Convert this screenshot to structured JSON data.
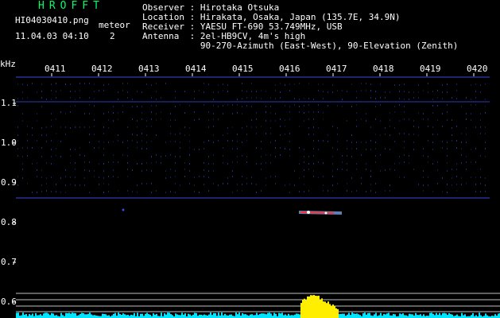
{
  "header": {
    "app_title": "HROFFT",
    "file_name": "HI04030410.png",
    "capture_time": "11.04.03 04:10",
    "meteor_label": "meteor",
    "meteor_count": "2"
  },
  "station": {
    "observer": "Observer : Hirotaka Otsuka",
    "location": "Location : Hirakata, Osaka, Japan (135.7E, 34.9N)",
    "receiver": "Receiver : YAESU FT-690 53.749MHz, USB",
    "antenna": "Antenna  : 2el-HB9CV, 4m's high",
    "antenna_detail": "           90-270-Azimuth (East-West), 90-Elevation (Zenith)"
  },
  "axes": {
    "y_unit": "kHz",
    "time_ticks": [
      "0411",
      "0412",
      "0413",
      "0414",
      "0415",
      "0416",
      "0417",
      "0418",
      "0419",
      "0420"
    ],
    "freq_ticks": [
      "1.1",
      "1.0",
      "0.9",
      "0.8",
      "0.7",
      "0.6"
    ]
  },
  "colors": {
    "title": "#00ff66",
    "grid_dots": "#2a3aa0",
    "carrier_line": "#3a4ae0",
    "echo_core": "#ff3030",
    "echo_halo": "#8ab4ff",
    "meter_cyan": "#00e5ff",
    "meter_yellow": "#ffee00",
    "reference_lines": "#bfbfbf"
  }
}
